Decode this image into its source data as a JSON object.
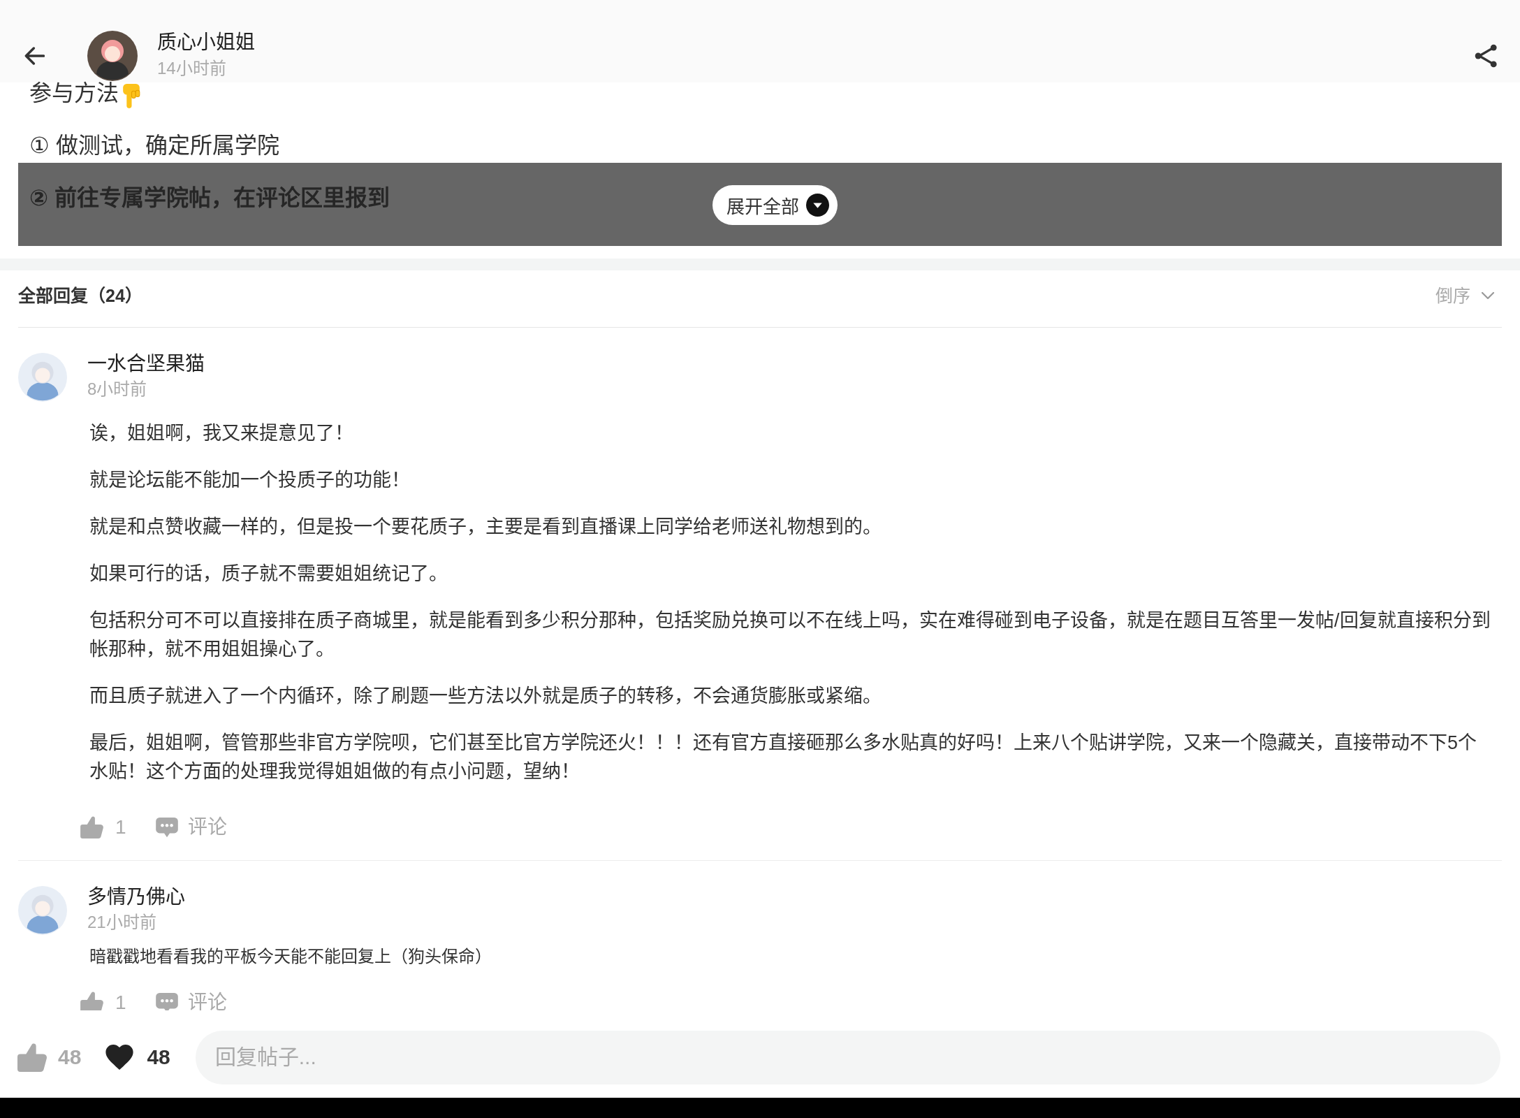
{
  "header": {
    "author": "质心小姐姐",
    "time": "14小时前"
  },
  "post": {
    "heading": "参与方法",
    "lines": [
      {
        "text": "① 做测试，确定所属学院",
        "bold": false,
        "masked": false
      },
      {
        "text": "② 前往专属学院帖，在评论区里报到",
        "bold": true,
        "masked": true
      }
    ],
    "expand_button": "展开全部"
  },
  "replies": {
    "title": "全部回复（24）",
    "sort": "倒序"
  },
  "comments": [
    {
      "kind": "rich",
      "author": "一水合坚果猫",
      "time": "8小时前",
      "paragraphs": [
        "诶，姐姐啊，我又来提意见了！",
        "就是论坛能不能加一个投质子的功能！",
        "就是和点赞收藏一样的，但是投一个要花质子，主要是看到直播课上同学给老师送礼物想到的。",
        "如果可行的话，质子就不需要姐姐统记了。",
        "包括积分可不可以直接排在质子商城里，就是能看到多少积分那种，包括奖励兑换可以不在线上吗，实在难得碰到电子设备，就是在题目互答里一发帖/回复就直接积分到帐那种，就不用姐姐操心了。",
        "而且质子就进入了一个内循环，除了刷题一些方法以外就是质子的转移，不会通货膨胀或紧缩。",
        "最后，姐姐啊，管管那些非官方学院呗，它们甚至比官方学院还火！！！还有官方直接砸那么多水贴真的好吗！上来八个贴讲学院，又来一个隐藏关，直接带动不下5个水贴！这个方面的处理我觉得姐姐做的有点小问题，望纳！"
      ],
      "likes": "1",
      "comment_label": "评论"
    },
    {
      "kind": "plain",
      "author": "多情乃佛心",
      "time": "21小时前",
      "paragraphs": [
        "暗戳戳地看看我的平板今天能不能回复上（狗头保命）"
      ],
      "likes": "1",
      "comment_label": "评论"
    }
  ],
  "bottom_bar": {
    "likes": "48",
    "liked": false,
    "favorites": "48",
    "favorited": true,
    "reply_placeholder": "回复帖子..."
  }
}
